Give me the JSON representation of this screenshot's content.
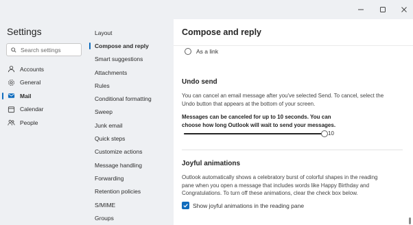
{
  "window": {
    "controls": [
      "minimize-icon",
      "maximize-icon",
      "close-icon"
    ]
  },
  "settings": {
    "title": "Settings",
    "search_placeholder": "Search settings"
  },
  "nav": {
    "items": [
      {
        "label": "Accounts",
        "icon": "person-icon",
        "active": false
      },
      {
        "label": "General",
        "icon": "gear-icon",
        "active": false
      },
      {
        "label": "Mail",
        "icon": "mail-icon",
        "active": true
      },
      {
        "label": "Calendar",
        "icon": "calendar-icon",
        "active": false
      },
      {
        "label": "People",
        "icon": "people-icon",
        "active": false
      }
    ]
  },
  "subnav": {
    "items": [
      {
        "label": "Layout",
        "active": false
      },
      {
        "label": "Compose and reply",
        "active": true
      },
      {
        "label": "Smart suggestions",
        "active": false
      },
      {
        "label": "Attachments",
        "active": false
      },
      {
        "label": "Rules",
        "active": false
      },
      {
        "label": "Conditional formatting",
        "active": false
      },
      {
        "label": "Sweep",
        "active": false
      },
      {
        "label": "Junk email",
        "active": false
      },
      {
        "label": "Quick steps",
        "active": false
      },
      {
        "label": "Customize actions",
        "active": false
      },
      {
        "label": "Message handling",
        "active": false
      },
      {
        "label": "Forwarding",
        "active": false
      },
      {
        "label": "Retention policies",
        "active": false
      },
      {
        "label": "S/MIME",
        "active": false
      },
      {
        "label": "Groups",
        "active": false
      }
    ]
  },
  "content": {
    "title": "Compose and reply",
    "link_option": {
      "label": "As a link",
      "selected": false
    },
    "undo_send": {
      "title": "Undo send",
      "description_line1": "You can cancel an email message after you've selected Send. To cancel, select the",
      "description_line2": "Undo button that appears at the bottom of your screen.",
      "bold_line1": "Messages can be canceled for up to 10 seconds. You can",
      "bold_line2": "choose how long Outlook will wait to send your messages.",
      "slider_value": "10",
      "slider_fraction": 1.0
    },
    "joyful": {
      "title": "Joyful animations",
      "line1": "Outlook automatically shows a celebratory burst of colorful shapes in the reading",
      "line2": "pane when you open a message that includes words like Happy Birthday and",
      "line3": "Congratulations. To turn off these animations, clear the check box below.",
      "checkbox_label": "Show joyful animations in the reading pane",
      "checked": true
    }
  },
  "colors": {
    "accent": "#0f6cbd",
    "sidebar_bg": "#eef0f3",
    "content_bg": "#ffffff"
  }
}
